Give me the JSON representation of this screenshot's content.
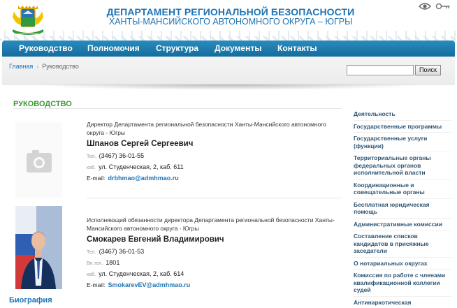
{
  "header": {
    "title_line1": "ДЕПАРТАМЕНТ РЕГИОНАЛЬНОЙ БЕЗОПАСНОСТИ",
    "title_line2": "ХАНТЫ-МАНСИЙСКОГО АВТОНОМНОГО ОКРУГА – ЮГРЫ",
    "icons": [
      "coat-of-arms",
      "eye-icon",
      "key-icon"
    ]
  },
  "nav": {
    "items": [
      "Руководство",
      "Полномочия",
      "Структура",
      "Документы",
      "Контакты"
    ]
  },
  "breadcrumb": {
    "home": "Главная",
    "separator": "›",
    "current": "Руководство"
  },
  "search": {
    "value": "",
    "button": "Поиск"
  },
  "main": {
    "heading": "РУКОВОДСТВО",
    "people": [
      {
        "post": "Директор Департамента региональной безопасности Ханты-Мансийского автономного округа - Югры",
        "name": "Шпанов Сергей Сергеевич",
        "phone_label": "Тел.",
        "phone": "(3467) 36-01-55",
        "office_label": "каб.",
        "office": "ул. Студенческая, 2, каб. 611",
        "email_label": "E-mail:",
        "email": "drbhmao@admhmao.ru"
      },
      {
        "post": "Исполняющий обязанности директора Департамента региональной безопасности Ханты-Мансийского автономного округа - Югры",
        "name": "Смокарев Евгений Владимирович",
        "phone_label": "Тел.",
        "phone": "(3467) 36-01-53",
        "ext_label": "Вн.тел.",
        "ext": "1801",
        "office_label": "каб.",
        "office": "ул. Студенческая, 2, каб. 614",
        "email_label": "E-mail:",
        "email": "SmokarevEV@admhmao.ru",
        "bio_link": "Биография"
      }
    ]
  },
  "sidebar": {
    "items": [
      "Деятельность",
      "Государственные программы",
      "Государственные услуги (функции)",
      "Территориальные органы федеральных органов исполнительной власти",
      "Координационные и совещательные органы",
      "Бесплатная юридическая помощь",
      "Административные комиссии",
      "Составление списков кандидатов в присяжные заседатели",
      "О нотариальных округах",
      "Комиссия по работе с членами квалификационной коллегии судей",
      "Антинаркотическая деятельность"
    ]
  },
  "colors": {
    "nav_blue": "#1f7fb3",
    "title_blue": "#1f74b5",
    "heading_green": "#3a9a2e",
    "sidebar_text": "#2f5573"
  }
}
